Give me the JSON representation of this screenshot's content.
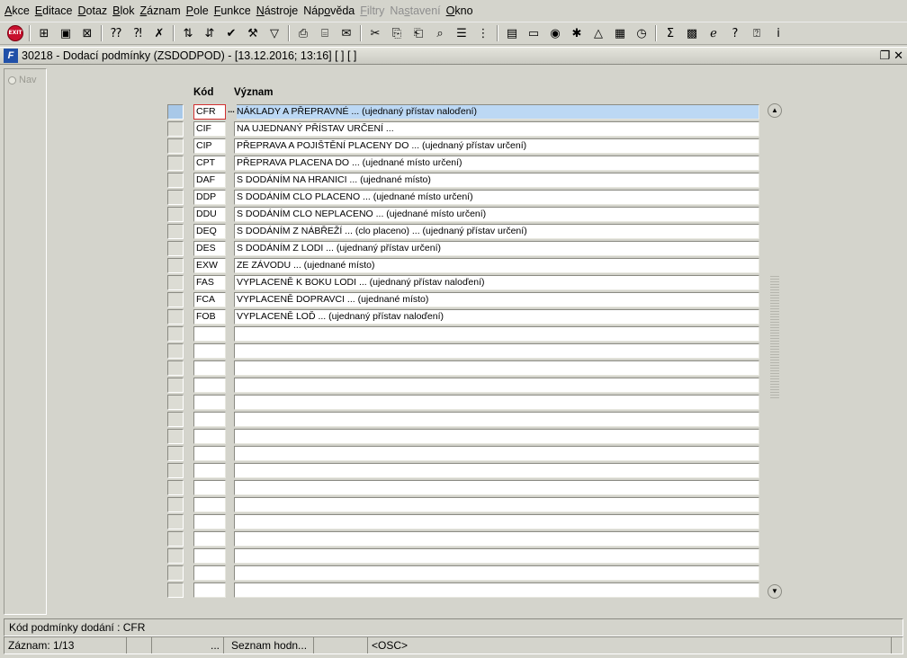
{
  "menu": [
    {
      "pre": "",
      "ul": "A",
      "post": "kce",
      "disabled": false
    },
    {
      "pre": "",
      "ul": "E",
      "post": "ditace",
      "disabled": false
    },
    {
      "pre": "",
      "ul": "D",
      "post": "otaz",
      "disabled": false
    },
    {
      "pre": "",
      "ul": "B",
      "post": "lok",
      "disabled": false
    },
    {
      "pre": "",
      "ul": "Z",
      "post": "áznam",
      "disabled": false
    },
    {
      "pre": "",
      "ul": "P",
      "post": "ole",
      "disabled": false
    },
    {
      "pre": "",
      "ul": "F",
      "post": "unkce",
      "disabled": false
    },
    {
      "pre": "",
      "ul": "N",
      "post": "ástroje",
      "disabled": false
    },
    {
      "pre": "Náp",
      "ul": "o",
      "post": "věda",
      "disabled": false
    },
    {
      "pre": "",
      "ul": "F",
      "post": "iltry",
      "disabled": true
    },
    {
      "pre": "Na",
      "ul": "s",
      "post": "tavení",
      "disabled": true
    },
    {
      "pre": "",
      "ul": "O",
      "post": "kno",
      "disabled": false
    }
  ],
  "toolbar": {
    "exit_label": "EXIT",
    "icons": [
      "add-record-icon",
      "save-icon",
      "delete-record-icon",
      "enter-query-icon",
      "execute-query-icon",
      "cancel-query-icon",
      "sort-asc-icon",
      "sort-desc-icon",
      "check-icon",
      "wrench-icon",
      "filter-icon",
      "print-icon",
      "print-preview-icon",
      "mail-icon",
      "cut-icon",
      "copy-icon",
      "paste-icon",
      "find-icon",
      "list-icon",
      "tree-icon",
      "clipboard-icon",
      "document-icon",
      "globe-icon",
      "settings-icon",
      "chart-icon",
      "report-icon",
      "clock-icon",
      "sum-icon",
      "excel-icon",
      "ie-icon",
      "help-icon",
      "context-help-icon",
      "info-icon"
    ]
  },
  "window": {
    "icon_letter": "F",
    "title": "30218 - Dodací podmínky (ZSDODPOD) - [13.12.2016; 13:16]  [ ]  [ ]"
  },
  "nav": {
    "label": "Nav"
  },
  "grid": {
    "code_header": "Kód",
    "meaning_header": "Význam",
    "rows": [
      {
        "code": "CFR",
        "meaning": "NÁKLADY A PŘEPRAVNÉ ... (ujednaný přístav naloďení)"
      },
      {
        "code": "CIF",
        "meaning": "NA UJEDNANÝ PŘÍSTAV URČENÍ ..."
      },
      {
        "code": "CIP",
        "meaning": "PŘEPRAVA A POJIŠTĚNÍ PLACENY DO ... (ujednaný přístav určení)"
      },
      {
        "code": "CPT",
        "meaning": "PŘEPRAVA PLACENA DO ... (ujednané místo určení)"
      },
      {
        "code": "DAF",
        "meaning": "S DODÁNÍM NA HRANICI ... (ujednané místo)"
      },
      {
        "code": "DDP",
        "meaning": "S DODÁNÍM CLO PLACENO ... (ujednané místo určení)"
      },
      {
        "code": "DDU",
        "meaning": "S DODÁNÍM CLO NEPLACENO ... (ujednané místo určení)"
      },
      {
        "code": "DEQ",
        "meaning": "S DODÁNÍM Z NÁBŘEŽÍ ... (clo placeno) ... (ujednaný přístav určení)"
      },
      {
        "code": "DES",
        "meaning": "S DODÁNÍM Z LODI ... (ujednaný přístav určení)"
      },
      {
        "code": "EXW",
        "meaning": "ZE ZÁVODU ... (ujednané místo)"
      },
      {
        "code": "FAS",
        "meaning": "VYPLACENĚ K BOKU LODI ... (ujednaný přístav naloďení)"
      },
      {
        "code": "FCA",
        "meaning": "VYPLACENĚ DOPRAVCI ... (ujednané místo)"
      },
      {
        "code": "FOB",
        "meaning": "VYPLACENĚ LOĎ ... (ujednaný přístav naloďení)"
      },
      {
        "code": "",
        "meaning": ""
      },
      {
        "code": "",
        "meaning": ""
      },
      {
        "code": "",
        "meaning": ""
      },
      {
        "code": "",
        "meaning": ""
      },
      {
        "code": "",
        "meaning": ""
      },
      {
        "code": "",
        "meaning": ""
      },
      {
        "code": "",
        "meaning": ""
      },
      {
        "code": "",
        "meaning": ""
      },
      {
        "code": "",
        "meaning": ""
      },
      {
        "code": "",
        "meaning": ""
      },
      {
        "code": "",
        "meaning": ""
      },
      {
        "code": "",
        "meaning": ""
      },
      {
        "code": "",
        "meaning": ""
      },
      {
        "code": "",
        "meaning": ""
      },
      {
        "code": "",
        "meaning": ""
      },
      {
        "code": "",
        "meaning": ""
      }
    ],
    "current_row": 0,
    "lov_label": "..."
  },
  "status": {
    "message": "Kód podmínky dodání : CFR",
    "record": "Záznam: 1/13",
    "ellipsis": "...",
    "list": "Seznam hodn...",
    "mode": "<OSC>"
  },
  "colors": {
    "selected_row": "#bcd8f4",
    "focus_border": "#d23030",
    "background": "#d4d4cc"
  }
}
